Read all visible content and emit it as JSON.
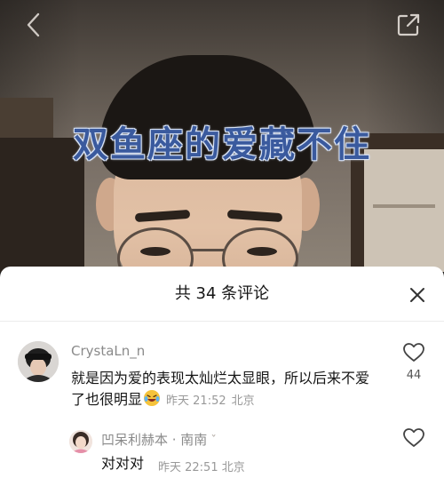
{
  "video": {
    "caption": "双鱼座的爱藏不住"
  },
  "icons": {
    "back": "chevron-left-icon",
    "share": "share-external-icon",
    "close": "close-icon",
    "like": "heart-outline-icon",
    "emoji": "crying-laughing-emoji-icon"
  },
  "comments_panel": {
    "title": "共 34 条评论",
    "comments": [
      {
        "username": "CrystaLn_n",
        "text": "就是因为爱的表现太灿烂太显眼，所以后来不爱了也很明显",
        "time": "昨天 21:52",
        "location": "北京",
        "likes": "44"
      }
    ],
    "reply": {
      "username": "凹呆利赫本 · 南南",
      "mark": "ˇ",
      "text": "对对对",
      "time": "昨天 22:51",
      "location": "北京"
    }
  },
  "colors": {
    "caption_fill": "#3a5a9e",
    "caption_outline": "#d8e3f5",
    "username": "#8a8a8a",
    "meta": "#999999"
  }
}
